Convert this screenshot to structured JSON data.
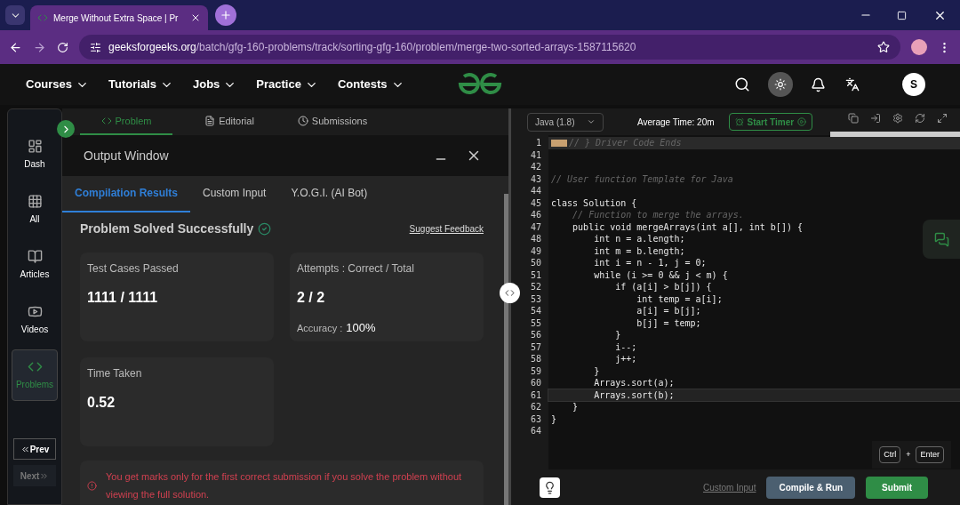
{
  "browser": {
    "tab_title": "Merge Without Extra Space | Pr",
    "url_host": "geeksforgeeks.org",
    "url_path": "/batch/gfg-160-problems/track/sorting-gfg-160/problem/merge-two-sorted-arrays-1587115620"
  },
  "nav": {
    "menus": [
      "Courses",
      "Tutorials",
      "Jobs",
      "Practice",
      "Contests"
    ],
    "avatar": "S"
  },
  "sidebar": {
    "items": [
      {
        "label": "Dash",
        "selected": false
      },
      {
        "label": "All",
        "selected": false
      },
      {
        "label": "Articles",
        "selected": false
      },
      {
        "label": "Videos",
        "selected": false
      },
      {
        "label": "Problems",
        "selected": true
      }
    ],
    "prev": {
      "label": "Prev",
      "disabled": false
    },
    "next": {
      "label": "Next",
      "disabled": true
    }
  },
  "problem_tabs": [
    {
      "label": "Problem",
      "selected": true
    },
    {
      "label": "Editorial",
      "selected": false
    },
    {
      "label": "Submissions",
      "selected": false
    }
  ],
  "output": {
    "title": "Output Window",
    "tabs": [
      {
        "label": "Compilation Results",
        "selected": true
      },
      {
        "label": "Custom Input",
        "selected": false
      },
      {
        "label": "Y.O.G.I. (AI Bot)",
        "selected": false
      }
    ],
    "status": "Problem Solved Successfully",
    "feedback": "Suggest Feedback",
    "cards": [
      {
        "label": "Test Cases Passed",
        "value": "1111 / 1111"
      },
      {
        "label": "Attempts : Correct / Total",
        "value": "2 / 2",
        "extra_label": "Accuracy :",
        "extra_value": "100%"
      },
      {
        "label": "Time Taken",
        "value": "0.52"
      }
    ],
    "notice": "You get marks only for the first correct submission if you solve the problem without viewing the full solution."
  },
  "editor": {
    "language": "Java (1.8)",
    "average_time": "Average Time: 20m",
    "timer": "Start Timer",
    "lines": [
      {
        "number": "1",
        "kind": "comment",
        "fold": true,
        "text": "// } Driver Code Ends"
      },
      {
        "number": "41"
      },
      {
        "number": "42"
      },
      {
        "number": "43",
        "kind": "comment",
        "text": "// User function Template for Java"
      },
      {
        "number": "44"
      },
      {
        "number": "45",
        "kind": "code",
        "text": "class Solution {"
      },
      {
        "number": "46",
        "kind": "comment",
        "text": "    // Function to merge the arrays."
      },
      {
        "number": "47",
        "kind": "code",
        "text": "    public void mergeArrays(int a[], int b[]) {"
      },
      {
        "number": "48",
        "kind": "code",
        "text": "        int n = a.length;"
      },
      {
        "number": "49",
        "kind": "code",
        "text": "        int m = b.length;"
      },
      {
        "number": "50",
        "kind": "code",
        "text": "        int i = n - 1, j = 0;"
      },
      {
        "number": "51",
        "kind": "code",
        "text": "        while (i >= 0 && j < m) {"
      },
      {
        "number": "52",
        "kind": "code",
        "text": "            if (a[i] > b[j]) {"
      },
      {
        "number": "53",
        "kind": "code",
        "text": "                int temp = a[i];"
      },
      {
        "number": "54",
        "kind": "code",
        "text": "                a[i] = b[j];"
      },
      {
        "number": "55",
        "kind": "code",
        "text": "                b[j] = temp;"
      },
      {
        "number": "56",
        "kind": "code",
        "text": "            }"
      },
      {
        "number": "57",
        "kind": "code",
        "text": "            i--;"
      },
      {
        "number": "58",
        "kind": "code",
        "text": "            j++;"
      },
      {
        "number": "59",
        "kind": "code",
        "text": "        }"
      },
      {
        "number": "60",
        "kind": "code",
        "text": "        Arrays.sort(a);"
      },
      {
        "number": "61",
        "kind": "code",
        "text": "        Arrays.sort(b);",
        "selected": true
      },
      {
        "number": "62",
        "kind": "code",
        "text": "    }"
      },
      {
        "number": "63",
        "kind": "code",
        "text": "}"
      },
      {
        "number": "64"
      }
    ],
    "keys": [
      "Ctrl",
      "+",
      "Enter"
    ],
    "custom_input": "Custom Input",
    "compile": "Compile & Run",
    "submit": "Submit"
  }
}
